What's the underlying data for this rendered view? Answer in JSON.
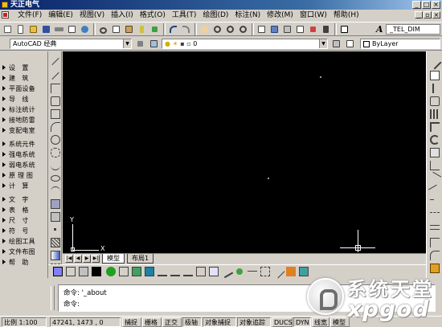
{
  "window": {
    "title": "天正电气",
    "minimize": "_",
    "maximize": "□",
    "close": "×"
  },
  "menu": [
    "文件(F)",
    "编辑(E)",
    "视图(V)",
    "插入(I)",
    "格式(O)",
    "工具(T)",
    "绘图(D)",
    "标注(N)",
    "修改(M)",
    "窗口(W)",
    "帮助(H)"
  ],
  "mdi_controls": {
    "minimize": "_",
    "restore": "▫",
    "close": "×"
  },
  "font_toolbar": {
    "glyph": "A",
    "font_value": "_TEL_DIM"
  },
  "props_toolbar": {
    "workspace": "AutoCAD 经典",
    "layer": "0",
    "color": "ByLayer"
  },
  "side_menu": [
    {
      "label": "设　置"
    },
    {
      "label": "建　筑"
    },
    {
      "label": "平面设备"
    },
    {
      "label": "导　线"
    },
    {
      "label": "标注统计"
    },
    {
      "label": "接地防雷"
    },
    {
      "label": "变配电室"
    },
    {
      "label": "系统元件"
    },
    {
      "label": "强电系统"
    },
    {
      "label": "弱电系统"
    },
    {
      "label": "原 理 图"
    },
    {
      "label": "计　算"
    },
    {
      "label": "文　字"
    },
    {
      "label": "表　格"
    },
    {
      "label": "尺　寸"
    },
    {
      "label": "符　号"
    },
    {
      "label": "绘图工具"
    },
    {
      "label": "文件布图"
    },
    {
      "label": "帮　助"
    }
  ],
  "canvas": {
    "ucs_y": "Y",
    "ucs_x": "X"
  },
  "tabs": {
    "model": "模型",
    "layout": "布局1"
  },
  "command_line": {
    "line1": "命令: '_about",
    "line2": "命令:"
  },
  "status_bar": {
    "scale": "比例 1:100",
    "coords": "47241, 1473 , 0",
    "buttons": [
      "捕捉",
      "栅格",
      "正交",
      "极轴",
      "对象捕捉",
      "对象追踪",
      "DUCS",
      "DYN",
      "线宽",
      "模型"
    ]
  },
  "watermark": {
    "line1": "系统天堂",
    "line2": "xpgod"
  },
  "colors": {
    "canvas_bg": "#000000",
    "chrome": "#d4d0c8",
    "titlebar": "#0a246a"
  }
}
